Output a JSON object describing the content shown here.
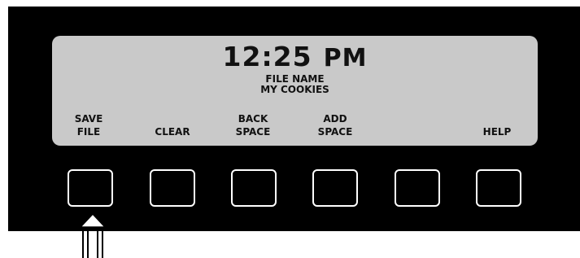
{
  "display": {
    "time": "12:25",
    "ampm": "PM",
    "field_label": "FILE NAME",
    "field_value": "MY COOKIES"
  },
  "softkeys": [
    {
      "line1": "SAVE",
      "line2": "FILE"
    },
    {
      "line1": "",
      "line2": "CLEAR"
    },
    {
      "line1": "BACK",
      "line2": "SPACE"
    },
    {
      "line1": "ADD",
      "line2": "SPACE"
    },
    {
      "line1": "",
      "line2": ""
    },
    {
      "line1": "",
      "line2": "HELP"
    }
  ],
  "pointer": {
    "icon": "up-arrow-icon",
    "target": "SAVE FILE"
  },
  "colors": {
    "panel": "#000000",
    "lcd": "#c9c9c9",
    "text": "#111111",
    "key_outline": "#ffffff"
  }
}
